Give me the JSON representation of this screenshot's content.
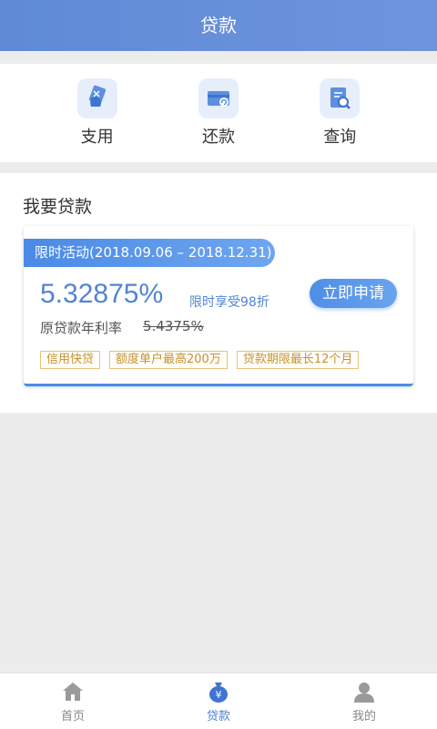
{
  "header": {
    "title": "贷款"
  },
  "actions": [
    {
      "label": "支用",
      "icon": "hand-card-icon"
    },
    {
      "label": "还款",
      "icon": "card-return-icon"
    },
    {
      "label": "查询",
      "icon": "search-document-icon"
    }
  ],
  "section": {
    "title": "我要贷款"
  },
  "loan_card": {
    "promo": "限时活动(2018.09.06 – 2018.12.31)",
    "rate": "5.32875%",
    "discount": "限时享受98折",
    "apply_label": "立即申请",
    "original_label": "原贷款年利率",
    "original_rate": "5.4375%",
    "tags": [
      "信用快贷",
      "额度单户最高200万",
      "贷款期限最长12个月"
    ]
  },
  "tabbar": {
    "items": [
      {
        "label": "首页",
        "icon": "home-icon",
        "active": false
      },
      {
        "label": "贷款",
        "icon": "money-bag-icon",
        "active": true
      },
      {
        "label": "我的",
        "icon": "user-icon",
        "active": false
      }
    ]
  },
  "colors": {
    "primary": "#5f8ad6",
    "accent": "#4a8ae6",
    "tag_border": "#e9c27a",
    "tag_text": "#c69232"
  }
}
